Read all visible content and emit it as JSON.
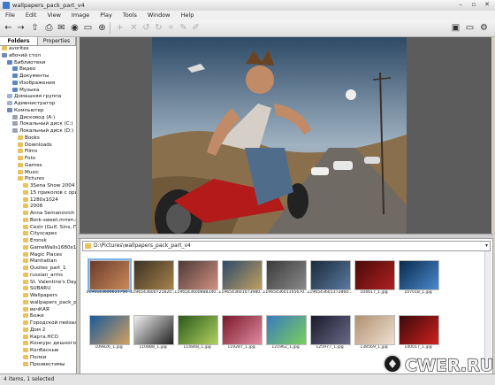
{
  "window": {
    "title": "wallpapers_pack_part_v4"
  },
  "menu": [
    "File",
    "Edit",
    "View",
    "Image",
    "Play",
    "Tools",
    "Window",
    "Help"
  ],
  "panel_tabs": [
    "Folders",
    "Properties"
  ],
  "tree": [
    {
      "label": "avorites",
      "icon": "star-icon",
      "indent": 0
    },
    {
      "label": "абочий стол",
      "icon": "desktop-icon",
      "indent": 0
    },
    {
      "label": "Библиотеки",
      "icon": "library-icon",
      "indent": 1
    },
    {
      "label": "Видео",
      "icon": "library-icon",
      "indent": 2
    },
    {
      "label": "Документы",
      "icon": "library-icon",
      "indent": 2
    },
    {
      "label": "Изображения",
      "icon": "library-icon",
      "indent": 2
    },
    {
      "label": "Музыка",
      "icon": "library-icon",
      "indent": 2
    },
    {
      "label": "Домашняя группа",
      "icon": "user-icon",
      "indent": 1
    },
    {
      "label": "Администратор",
      "icon": "user-icon",
      "indent": 1
    },
    {
      "label": "Компьютер",
      "icon": "computer-icon",
      "indent": 1
    },
    {
      "label": "Дисковод (A:)",
      "icon": "drive-icon",
      "indent": 2
    },
    {
      "label": "Локальный диск (C:)",
      "icon": "drive-icon",
      "indent": 2
    },
    {
      "label": "Локальный диск (D:)",
      "icon": "drive-icon",
      "indent": 2
    },
    {
      "label": "Books",
      "icon": "folder-icon",
      "indent": 3
    },
    {
      "label": "Downloads",
      "icon": "folder-icon",
      "indent": 3
    },
    {
      "label": "Films",
      "icon": "folder-icon",
      "indent": 3
    },
    {
      "label": "Foto",
      "icon": "folder-icon",
      "indent": 3
    },
    {
      "label": "Games",
      "icon": "folder-icon",
      "indent": 3
    },
    {
      "label": "Music",
      "icon": "folder-icon",
      "indent": 3
    },
    {
      "label": "Pictures",
      "icon": "folder-icon",
      "indent": 3
    },
    {
      "label": "3Sena Show 2004 (I",
      "icon": "folder-icon",
      "indent": 4
    },
    {
      "label": "15 приколов с оригин",
      "icon": "folder-icon",
      "indent": 4
    },
    {
      "label": "1280x1024",
      "icon": "folder-icon",
      "indent": 4
    },
    {
      "label": "2008",
      "icon": "folder-icon",
      "indent": 4
    },
    {
      "label": "Anna Semanovich (",
      "icon": "folder-icon",
      "indent": 4
    },
    {
      "label": "Bork-sweet.mmm.ru",
      "icon": "folder-icon",
      "indent": 4
    },
    {
      "label": "Cestr (Gulf, Sins, Пс",
      "icon": "folder-icon",
      "indent": 4
    },
    {
      "label": "Cityscapes",
      "icon": "folder-icon",
      "indent": 4
    },
    {
      "label": "Eronsk",
      "icon": "folder-icon",
      "indent": 4
    },
    {
      "label": "GameWalls1680x10",
      "icon": "folder-icon",
      "indent": 4
    },
    {
      "label": "Magic Places",
      "icon": "folder-icon",
      "indent": 4
    },
    {
      "label": "Manhattan",
      "icon": "folder-icon",
      "indent": 4
    },
    {
      "label": "Quotes_part_1",
      "icon": "folder-icon",
      "indent": 4
    },
    {
      "label": "russian_arms",
      "icon": "folder-icon",
      "indent": 4
    },
    {
      "label": "St. Valentine's Day",
      "icon": "folder-icon",
      "indent": 4
    },
    {
      "label": "SUBARU",
      "icon": "folder-icon",
      "indent": 4
    },
    {
      "label": "Wallpapers",
      "icon": "folder-icon",
      "indent": 4
    },
    {
      "label": "wallpapers_pack_pa",
      "icon": "folder-icon",
      "indent": 4
    },
    {
      "label": "вечКАЯ",
      "icon": "folder-icon",
      "indent": 4
    },
    {
      "label": "Боже",
      "icon": "folder-icon",
      "indent": 4
    },
    {
      "label": "Городской пейзаж",
      "icon": "folder-icon",
      "indent": 4
    },
    {
      "label": "Дом 2",
      "icon": "folder-icon",
      "indent": 4
    },
    {
      "label": "Карта.НСО",
      "icon": "folder-icon",
      "indent": 4
    },
    {
      "label": "Конкурс дешного ра",
      "icon": "folder-icon",
      "indent": 4
    },
    {
      "label": "Колбасные",
      "icon": "folder-icon",
      "indent": 4
    },
    {
      "label": "Полки",
      "icon": "folder-icon",
      "indent": 4
    },
    {
      "label": "Прозвестимы",
      "icon": "folder-icon",
      "indent": 4
    }
  ],
  "path": "D:\\Pictures\\wallpapers_pack_part_v4",
  "thumbnails": [
    {
      "caption": "1196543600621700...",
      "colors": [
        "#6a3a2a",
        "#c98a5a"
      ]
    },
    {
      "caption": "1196543600721820...",
      "colors": [
        "#3b3226",
        "#a8824a"
      ]
    },
    {
      "caption": "1196543600888340...",
      "colors": [
        "#4c3a36",
        "#d09080"
      ]
    },
    {
      "caption": "1196543601073980...",
      "colors": [
        "#2c4a6a",
        "#c0a060"
      ]
    },
    {
      "caption": "1196543601165670...",
      "colors": [
        "#3a3a3a",
        "#8a8a8a"
      ]
    },
    {
      "caption": "1196543601372860...",
      "colors": [
        "#1a2a3a",
        "#5a7aa0"
      ]
    },
    {
      "caption": "104617_1.jpg",
      "colors": [
        "#4a0a0a",
        "#b02020"
      ]
    },
    {
      "caption": "107018_1.jpg",
      "colors": [
        "#0a2a4a",
        "#4a8ad0"
      ]
    },
    {
      "caption": "109826_1.jpg",
      "colors": [
        "#1a5a9a",
        "#d0a060"
      ]
    },
    {
      "caption": "110888_1.jpg",
      "colors": [
        "#f0f0f0",
        "#202020"
      ]
    },
    {
      "caption": "114848_1.jpg",
      "colors": [
        "#2a5a1a",
        "#b0d060"
      ]
    },
    {
      "caption": "119287_1.jpg",
      "colors": [
        "#7a1a2a",
        "#e08aa0"
      ]
    },
    {
      "caption": "121962_1.jpg",
      "colors": [
        "#3a7ac0",
        "#7ad05a"
      ]
    },
    {
      "caption": "125977_1.jpg",
      "colors": [
        "#1a1a2a",
        "#6a6a8a"
      ]
    },
    {
      "caption": "138569_1.jpg",
      "colors": [
        "#b09070",
        "#f0e0d0"
      ]
    },
    {
      "caption": "140017_1.jpg",
      "colors": [
        "#3a0a0a",
        "#d02020"
      ]
    }
  ],
  "status": "4 items, 1 selected",
  "watermark": "CWER.RU"
}
